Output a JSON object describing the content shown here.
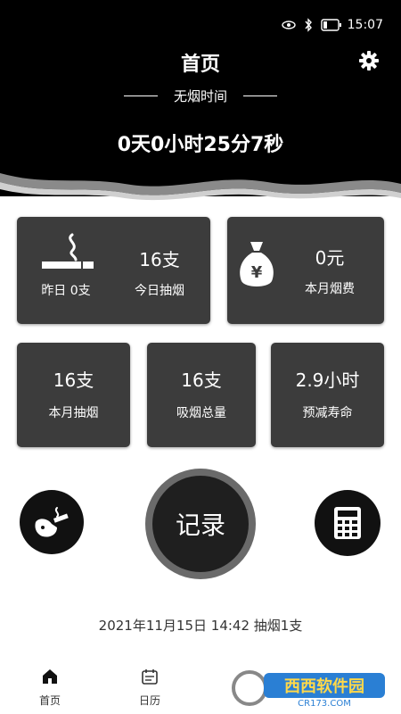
{
  "status_bar": {
    "time": "15:07"
  },
  "header": {
    "title": "首页",
    "subtitle": "无烟时间",
    "timer": "0天0小时25分7秒"
  },
  "stats": {
    "yesterday": "昨日 0支",
    "today_value": "16支",
    "today_label": "今日抽烟",
    "cost_value": "0元",
    "cost_label": "本月烟费",
    "month_value": "16支",
    "month_label": "本月抽烟",
    "total_value": "16支",
    "total_label": "吸烟总量",
    "life_value": "2.9小时",
    "life_label": "预减寿命"
  },
  "actions": {
    "record_label": "记录"
  },
  "last_record": "2021年11月15日 14:42  抽烟1支",
  "tabbar": {
    "tabs": [
      {
        "label": "首页"
      },
      {
        "label": "日历"
      }
    ]
  },
  "watermark": {
    "text": "西西软件园",
    "sub": "CR173.COM"
  },
  "colors": {
    "header_bg": "#000000",
    "card_bg": "#3c3c3c",
    "accent": "#111111"
  }
}
